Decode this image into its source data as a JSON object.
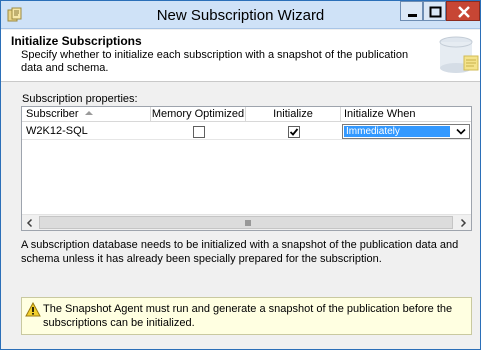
{
  "window": {
    "title": "New Subscription Wizard",
    "app_icon": "wizard-app-icon",
    "controls": {
      "minimize_icon": "minimize-icon",
      "maximize_icon": "maximize-icon",
      "close_icon": "close-icon"
    }
  },
  "header": {
    "title": "Initialize Subscriptions",
    "description": "Specify whether to initialize each subscription with a snapshot of the publication data and schema.",
    "art_icon": "database-art-icon"
  },
  "grid": {
    "label": "Subscription properties:",
    "columns": [
      "Subscriber",
      "Memory Optimized",
      "Initialize",
      "Initialize When"
    ],
    "sort_icon": "sort-ascending-icon",
    "rows": [
      {
        "subscriber": "W2K12-SQL",
        "memory_optimized": false,
        "initialize": true,
        "initialize_when": "Immediately"
      }
    ],
    "scrollbar": {
      "left_icon": "scroll-left-icon",
      "right_icon": "scroll-right-icon",
      "grip_icon": "scroll-grip-icon"
    }
  },
  "info_text": "A subscription database needs to be initialized with a snapshot of the publication data and schema unless it has already been specially prepared for the subscription.",
  "warning": {
    "icon": "warning-icon",
    "text": "The Snapshot Agent must run and generate a snapshot of the publication before the subscriptions can be initialized."
  },
  "colors": {
    "selection": "#3399ff",
    "warning_bg": "#ffffe1",
    "close_button": "#c74634",
    "titlebar": "#cfe2f7"
  }
}
